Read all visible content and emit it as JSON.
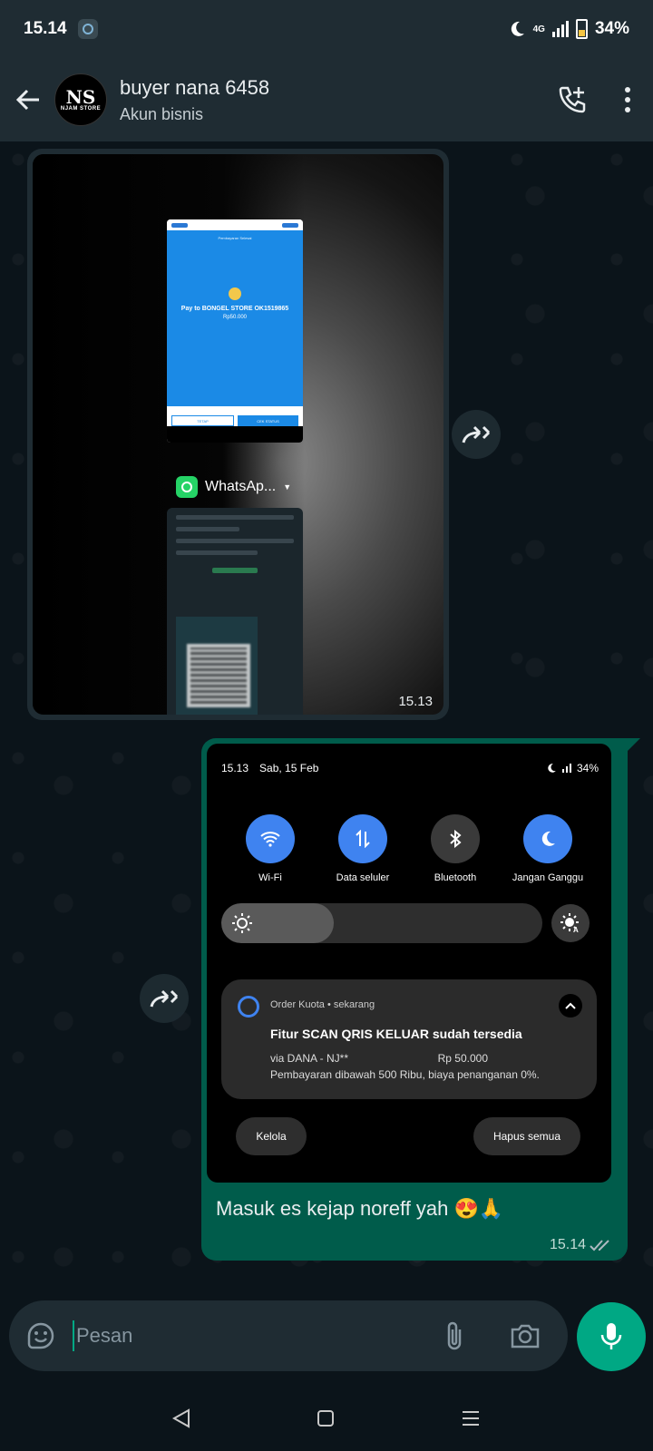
{
  "status_bar": {
    "time": "15.14",
    "network": "4G",
    "battery": "34%"
  },
  "header": {
    "contact_name": "buyer nana 6458",
    "contact_subtitle": "Akun bisnis",
    "avatar_text": "NJAM STORE",
    "avatar_mark": "NS"
  },
  "messages": {
    "incoming_image": {
      "pay_title": "Pay to BONGEL STORE OK1519865",
      "pay_amount": "Rp50.000",
      "pay_header": "Pembayaran Selesai",
      "btn_left": "TETAP",
      "btn_right": "CEK STATUS",
      "app_chip_label": "WhatsAp...",
      "time": "15.13"
    },
    "outgoing": {
      "qs_time": "15.13",
      "qs_date": "Sab, 15 Feb",
      "qs_battery": "34%",
      "tiles": [
        {
          "label": "Wi-Fi",
          "state": "on",
          "icon": "wifi-icon"
        },
        {
          "label": "Data seluler",
          "state": "on",
          "icon": "data-icon"
        },
        {
          "label": "Bluetooth",
          "state": "off",
          "icon": "bluetooth-icon"
        },
        {
          "label": "Jangan Ganggu",
          "state": "on",
          "icon": "moon-icon"
        }
      ],
      "brightness_level": 0.35,
      "notification": {
        "app_line": "Order Kuota • sekarang",
        "title": "Fitur SCAN QRIS KELUAR sudah tersedia",
        "via": "via DANA - NJ**",
        "amount": "Rp 50.000",
        "note": "Pembayaran dibawah 500 Ribu, biaya penanganan 0%."
      },
      "btn_manage": "Kelola",
      "btn_clear": "Hapus semua",
      "text": "Masuk es kejap noreff yah 😍🙏",
      "time": "15.14"
    }
  },
  "input": {
    "placeholder": "Pesan"
  },
  "colors": {
    "header_bg": "#1f2c33",
    "chat_bg": "#0b141a",
    "outgoing_bubble": "#005c4b",
    "accent": "#00a884",
    "tile_on": "#3f83f0"
  }
}
